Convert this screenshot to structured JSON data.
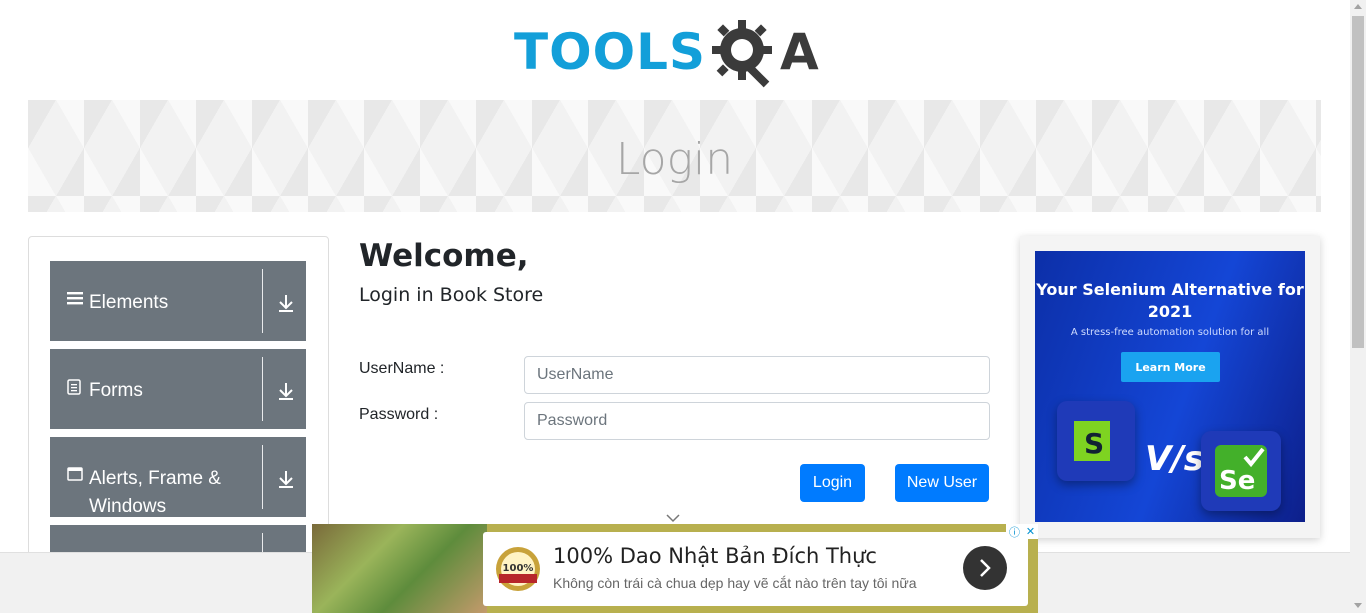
{
  "header": {
    "logo_left": "TOOLS",
    "logo_right": "A"
  },
  "banner": {
    "title": "Login"
  },
  "sidebar": {
    "groups": [
      {
        "label": "Elements",
        "icon": "menu-icon"
      },
      {
        "label": "Forms",
        "icon": "document-icon"
      },
      {
        "label": "Alerts, Frame &",
        "label_line2": "Windows",
        "icon": "window-icon"
      }
    ]
  },
  "main": {
    "heading": "Welcome,",
    "subheading": "Login in Book Store",
    "username_label": "UserName :",
    "username_placeholder": "UserName",
    "password_label": "Password :",
    "password_placeholder": "Password",
    "login_button": "Login",
    "new_user_button": "New User"
  },
  "side_ad": {
    "title": "Your Selenium Alternative for 2021",
    "subtitle": "A stress-free automation solution for all",
    "cta": "Learn More",
    "vs": "V/s",
    "left_logo": "S",
    "right_logo": "Se"
  },
  "bottom_ad": {
    "title": "100% Dao Nhật Bản Đích Thực",
    "subtitle": "Không còn trái cà chua dẹp hay vẽ cắt nào trên tay tôi nữa",
    "badge_text": "100%"
  },
  "colors": {
    "brand_blue": "#139fd9",
    "button_primary": "#007bff",
    "sidebar_group": "#6c757d"
  }
}
